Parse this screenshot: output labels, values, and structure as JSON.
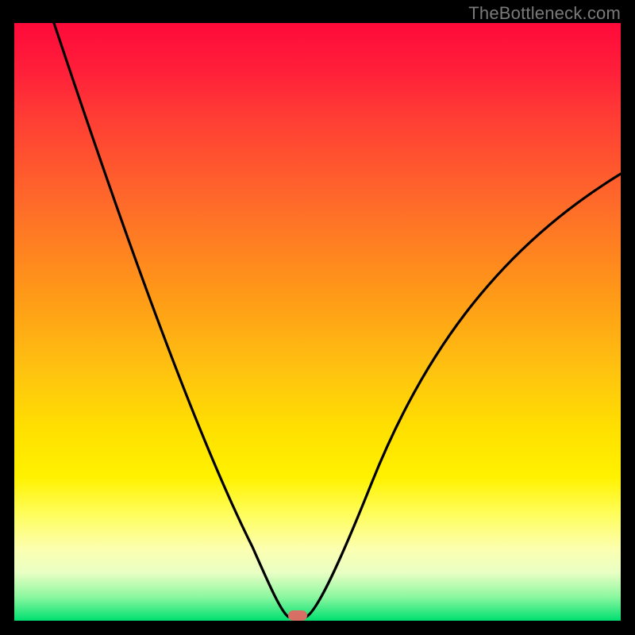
{
  "watermark": "TheBottleneck.com",
  "marker": {
    "x_fraction": 0.465,
    "y_fraction": 0.994
  },
  "chart_data": {
    "type": "line",
    "title": "",
    "xlabel": "",
    "ylabel": "",
    "xlim": [
      0,
      1
    ],
    "ylim": [
      0,
      1
    ],
    "series": [
      {
        "name": "bottleneck-curve",
        "x": [
          0.0,
          0.05,
          0.1,
          0.15,
          0.2,
          0.25,
          0.3,
          0.35,
          0.4,
          0.43,
          0.45,
          0.47,
          0.5,
          0.55,
          0.6,
          0.65,
          0.7,
          0.75,
          0.8,
          0.85,
          0.9,
          0.95,
          1.0
        ],
        "y": [
          1.0,
          0.89,
          0.78,
          0.67,
          0.56,
          0.46,
          0.35,
          0.24,
          0.12,
          0.04,
          0.0,
          0.0,
          0.05,
          0.18,
          0.3,
          0.4,
          0.48,
          0.54,
          0.6,
          0.65,
          0.69,
          0.72,
          0.75
        ]
      }
    ],
    "background_gradient": {
      "top": "#ff0a3a",
      "mid": "#ffe000",
      "bottom": "#00e070"
    },
    "marker": {
      "x": 0.465,
      "y": 0.0,
      "color": "#d86f64"
    }
  }
}
